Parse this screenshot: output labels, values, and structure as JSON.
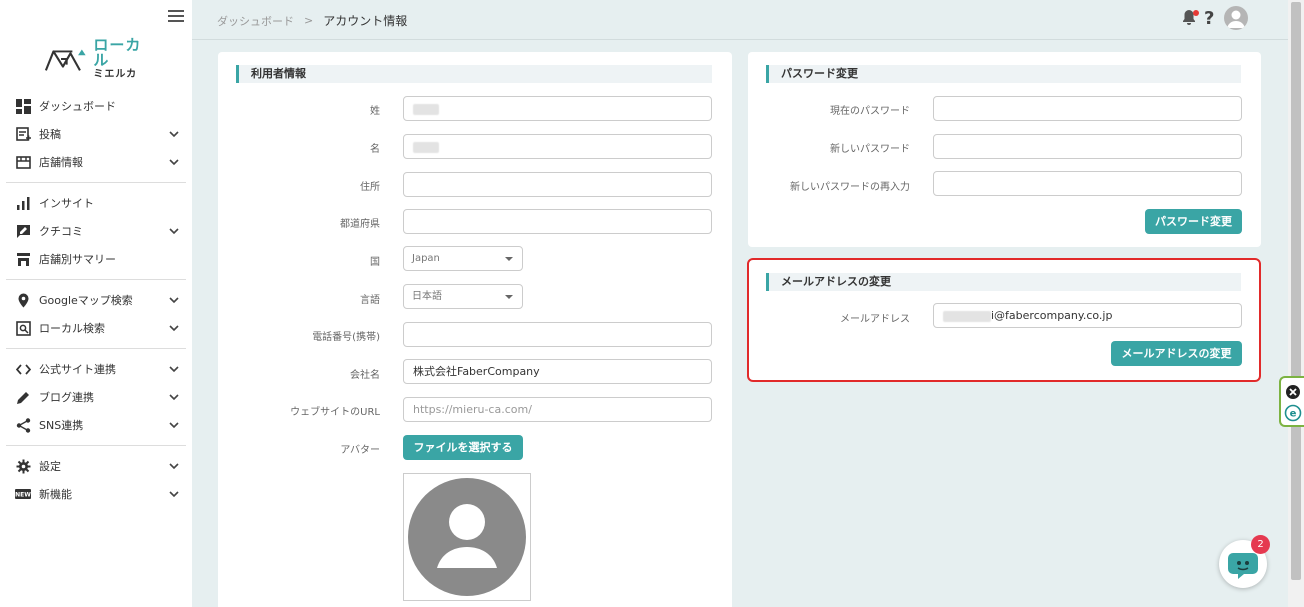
{
  "sidebar": {
    "logo_line1": "ローカル",
    "logo_line2": "ミエルカ",
    "items": [
      {
        "label": "ダッシュボード",
        "icon": "dashboard-icon",
        "chevron": false
      },
      {
        "label": "投稿",
        "icon": "post-icon",
        "chevron": true
      },
      {
        "label": "店舗情報",
        "icon": "store-info-icon",
        "chevron": true
      },
      {
        "label": "インサイト",
        "icon": "insight-icon",
        "chevron": false
      },
      {
        "label": "クチコミ",
        "icon": "review-icon",
        "chevron": true
      },
      {
        "label": "店舗別サマリー",
        "icon": "store-summary-icon",
        "chevron": false
      },
      {
        "label": "Googleマップ検索",
        "icon": "map-pin-icon",
        "chevron": true
      },
      {
        "label": "ローカル検索",
        "icon": "local-search-icon",
        "chevron": true
      },
      {
        "label": "公式サイト連携",
        "icon": "code-icon",
        "chevron": true
      },
      {
        "label": "ブログ連携",
        "icon": "pencil-icon",
        "chevron": true
      },
      {
        "label": "SNS連携",
        "icon": "share-icon",
        "chevron": true
      },
      {
        "label": "設定",
        "icon": "gear-icon",
        "chevron": true
      },
      {
        "label": "新機能",
        "icon": "new-badge-icon",
        "chevron": true
      }
    ]
  },
  "header": {
    "breadcrumb_parent": "ダッシュボード",
    "breadcrumb_sep": ">",
    "breadcrumb_current": "アカウント情報",
    "help_symbol": "?"
  },
  "user_info": {
    "title": "利用者情報",
    "fields": {
      "last_name_label": "姓",
      "first_name_label": "名",
      "address_label": "住所",
      "prefecture_label": "都道府県",
      "country_label": "国",
      "country_value": "Japan",
      "language_label": "言語",
      "language_value": "日本語",
      "phone_label": "電話番号(携帯)",
      "company_label": "会社名",
      "company_value": "株式会社FaberCompany",
      "website_label": "ウェブサイトのURL",
      "website_placeholder": "https://mieru-ca.com/",
      "avatar_label": "アバター",
      "file_button": "ファイルを選択する"
    }
  },
  "password": {
    "title": "パスワード変更",
    "current_label": "現在のパスワード",
    "new_label": "新しいパスワード",
    "confirm_label": "新しいパスワードの再入力",
    "button": "パスワード変更"
  },
  "email": {
    "title": "メールアドレスの変更",
    "label": "メールアドレス",
    "value_suffix": "i@fabercompany.co.jp",
    "button": "メールアドレスの変更"
  },
  "chat": {
    "badge": "2"
  },
  "colors": {
    "accent": "#3aa5a5",
    "highlight": "#e12a2a",
    "badge": "#e53950"
  }
}
